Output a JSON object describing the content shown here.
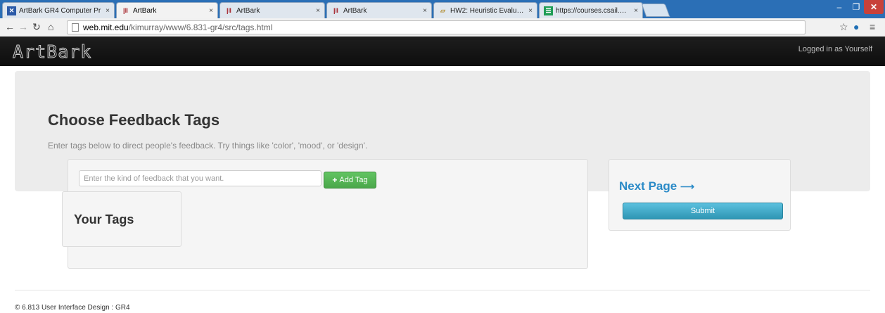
{
  "browser": {
    "tabs": [
      {
        "title": "ArtBark GR4 Computer Pr",
        "icon": "people-icon"
      },
      {
        "title": "ArtBark",
        "icon": "artbark-icon"
      },
      {
        "title": "ArtBark",
        "icon": "artbark-icon"
      },
      {
        "title": "ArtBark",
        "icon": "artbark-icon"
      },
      {
        "title": "HW2: Heuristic Evaluation",
        "icon": "folder-icon"
      },
      {
        "title": "https://courses.csail.mit.e",
        "icon": "spreadsheet-icon"
      }
    ],
    "url_host": "web.mit.edu",
    "url_path": "/kimurray/www/6.831-gr4/src/tags.html"
  },
  "header": {
    "logo": "ArtBark",
    "logged_in": "Logged in as Yourself"
  },
  "hero": {
    "title": "Choose Feedback Tags",
    "subtitle": "Enter tags below to direct people's feedback. Try things like 'color', 'mood', or 'design'."
  },
  "tags": {
    "input_placeholder": "Enter the kind of feedback that you want.",
    "add_button": "Add Tag",
    "your_tags_heading": "Your Tags"
  },
  "next": {
    "title": "Next Page",
    "submit": "Submit"
  },
  "footer": {
    "text": "© 6.813 User Interface Design : GR4"
  },
  "colors": {
    "accent": "#2a8ac7",
    "success": "#4aa74a",
    "info": "#2f96b4"
  }
}
